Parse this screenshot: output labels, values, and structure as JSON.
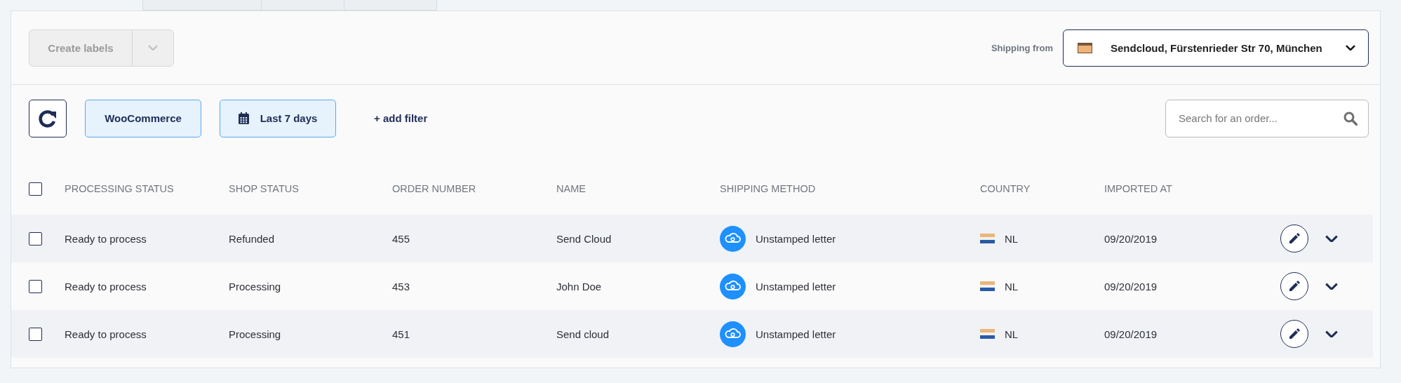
{
  "tabs": [
    {
      "selected": false
    },
    {
      "selected": false
    },
    {
      "selected": false
    }
  ],
  "toolbar": {
    "create_button": {
      "label": "Create labels",
      "disabled": true
    },
    "shipping_from": {
      "label": "Shipping from",
      "value": "Sendcloud, Fürstenrieder Str 70, München"
    }
  },
  "filters": {
    "chips": [
      {
        "kind": "text",
        "label": "WooCommerce"
      },
      {
        "kind": "date",
        "label": "Last 7 days"
      }
    ],
    "add_filter": "+ add filter",
    "search": {
      "placeholder": "Search for an order..."
    }
  },
  "table": {
    "select_all": {
      "checked": false
    },
    "columns": [
      "PROCESSING STATUS",
      "SHOP STATUS",
      "ORDER NUMBER",
      "NAME",
      "SHIPPING METHOD",
      "COUNTRY",
      "IMPORTED AT"
    ],
    "rows": [
      {
        "checked": false,
        "processing_status": "Ready to process",
        "shop_status": "Refunded",
        "order_number": "455",
        "name": "Send Cloud",
        "shipping_method": "Unstamped letter",
        "country": "NL",
        "imported_at": "09/20/2019"
      },
      {
        "checked": false,
        "processing_status": "Ready to process",
        "shop_status": "Processing",
        "order_number": "453",
        "name": "John Doe",
        "shipping_method": "Unstamped letter",
        "country": "NL",
        "imported_at": "09/20/2019"
      },
      {
        "checked": false,
        "processing_status": "Ready to process",
        "shop_status": "Processing",
        "order_number": "451",
        "name": "Send cloud",
        "shipping_method": "Unstamped letter",
        "country": "NL",
        "imported_at": "09/20/2019"
      }
    ]
  }
}
